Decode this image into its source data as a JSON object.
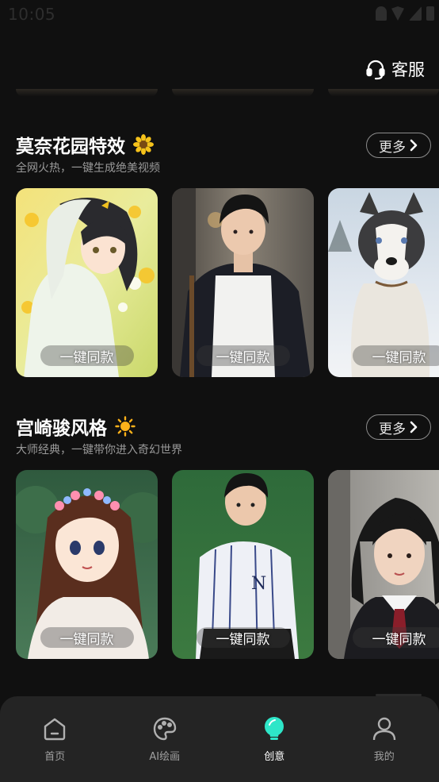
{
  "status_bar": {
    "time": "10:05"
  },
  "header": {
    "service_label": "客服",
    "service_icon": "headset-icon"
  },
  "sections": [
    {
      "title": "莫奈花园特效",
      "title_icon": "sunflower-icon",
      "subtitle": "全网火热，一键生成绝美视频",
      "more_label": "更多",
      "cards": [
        {
          "subject": "anime girl among yellow flowers",
          "action_label": "一键同款"
        },
        {
          "subject": "young man in white tee and black jacket",
          "action_label": "一键同款"
        },
        {
          "subject": "husky dog in snow",
          "action_label": "一键同款"
        }
      ]
    },
    {
      "title": "宫崎骏风格",
      "title_icon": "sun-icon",
      "subtitle": "大师经典，一键带你进入奇幻世界",
      "more_label": "更多",
      "cards": [
        {
          "subject": "anime girl with flower crown",
          "action_label": "一键同款"
        },
        {
          "subject": "boy in striped baseball shirt on grass",
          "action_label": "一键同款"
        },
        {
          "subject": "girl in school uniform",
          "action_label": "一键同款"
        }
      ]
    }
  ],
  "tabbar": {
    "active": "创意",
    "items": [
      {
        "label": "首页",
        "icon": "home-icon"
      },
      {
        "label": "AI绘画",
        "icon": "palette-icon"
      },
      {
        "label": "创意",
        "icon": "lightbulb-icon"
      },
      {
        "label": "我的",
        "icon": "user-icon"
      }
    ]
  },
  "colors": {
    "background": "#101010",
    "tabbar": "#242424",
    "accent": "#2ee6c8",
    "muted_text": "#9a9a9a"
  }
}
